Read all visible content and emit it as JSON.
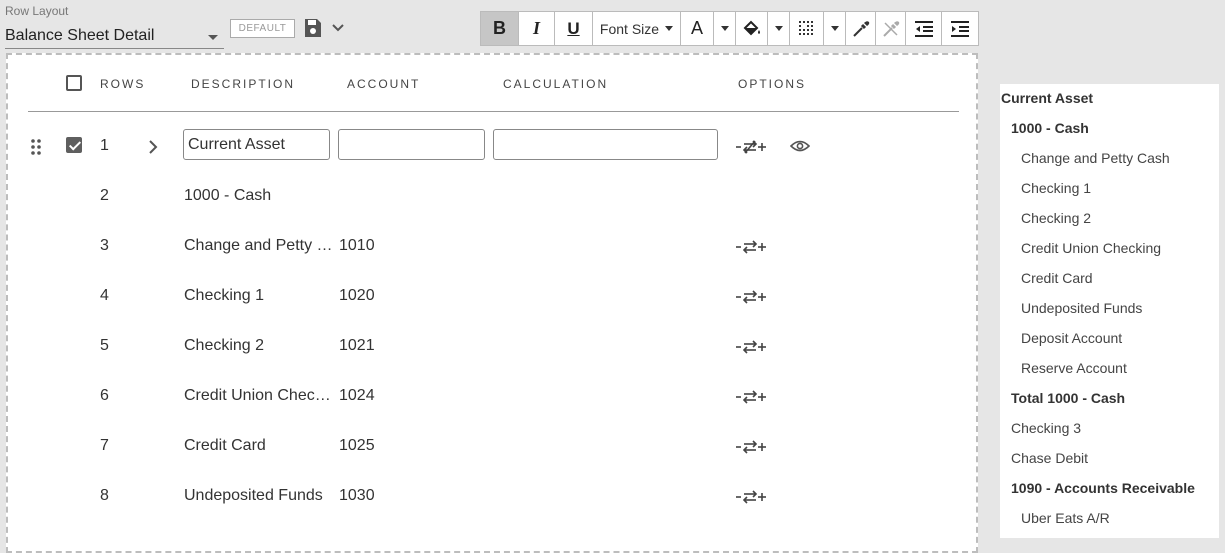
{
  "layout": {
    "label": "Row Layout",
    "selected": "Balance Sheet Detail",
    "default_label": "DEFAULT"
  },
  "toolbar": {
    "bold": "B",
    "italic": "I",
    "underline": "U",
    "font_size": "Font Size",
    "text_color": "A"
  },
  "table": {
    "headers": {
      "rows": "ROWS",
      "description": "DESCRIPTION",
      "account": "ACCOUNT",
      "calculation": "CALCULATION",
      "options": "OPTIONS"
    },
    "rows": [
      {
        "num": "1",
        "description": "Current Asset",
        "account": "",
        "calculation": "",
        "checked": true
      },
      {
        "num": "2",
        "description": "1000 - Cash",
        "account": ""
      },
      {
        "num": "3",
        "description": "Change and Petty …",
        "account": "1010"
      },
      {
        "num": "4",
        "description": "Checking 1",
        "account": "1020"
      },
      {
        "num": "5",
        "description": "Checking 2",
        "account": "1021"
      },
      {
        "num": "6",
        "description": "Credit Union Chec…",
        "account": "1024"
      },
      {
        "num": "7",
        "description": "Credit Card",
        "account": "1025"
      },
      {
        "num": "8",
        "description": "Undeposited Funds",
        "account": "1030"
      }
    ]
  },
  "preview": {
    "items": [
      {
        "label": "Current Asset",
        "bold": true,
        "indent": 0
      },
      {
        "label": "1000 - Cash",
        "bold": true,
        "indent": 1
      },
      {
        "label": "Change and Petty Cash",
        "bold": false,
        "indent": 2
      },
      {
        "label": "Checking 1",
        "bold": false,
        "indent": 2
      },
      {
        "label": "Checking 2",
        "bold": false,
        "indent": 2
      },
      {
        "label": "Credit Union Checking",
        "bold": false,
        "indent": 2
      },
      {
        "label": "Credit Card",
        "bold": false,
        "indent": 2
      },
      {
        "label": "Undeposited Funds",
        "bold": false,
        "indent": 2
      },
      {
        "label": "Deposit Account",
        "bold": false,
        "indent": 2
      },
      {
        "label": "Reserve Account",
        "bold": false,
        "indent": 2
      },
      {
        "label": "Total 1000 - Cash",
        "bold": true,
        "indent": 1
      },
      {
        "label": "Checking 3",
        "bold": false,
        "indent": 1
      },
      {
        "label": "Chase Debit",
        "bold": false,
        "indent": 1
      },
      {
        "label": "1090 - Accounts Receivable",
        "bold": true,
        "indent": 1
      },
      {
        "label": "Uber Eats A/R",
        "bold": false,
        "indent": 2
      }
    ]
  },
  "icons": {
    "save": "floppy-disk-icon",
    "options_sort": "sort-arrows-icon",
    "options_no_sort": "sort-disabled-icon",
    "eye": "eye-icon"
  },
  "colors": {
    "active_button": "#c6c6c6",
    "page_bg": "#e6e6e6"
  }
}
